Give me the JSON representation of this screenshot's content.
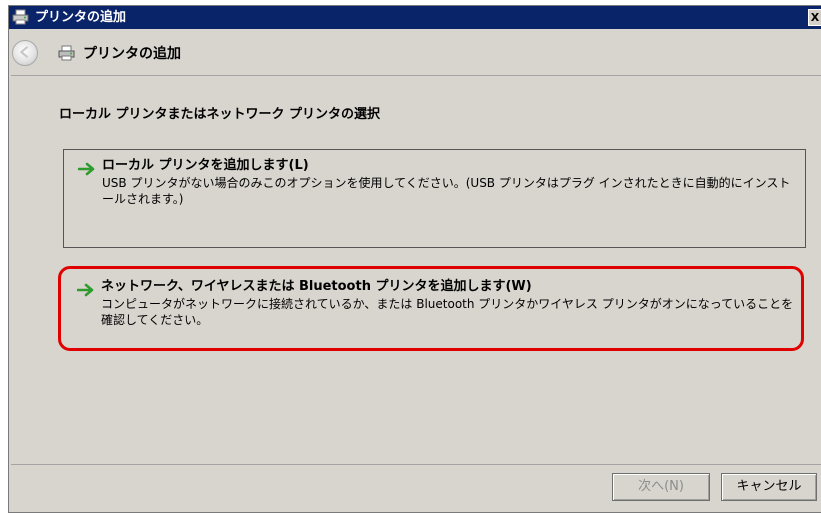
{
  "window": {
    "title": "プリンタの追加",
    "close_label": "X"
  },
  "nav": {
    "title": "プリンタの追加"
  },
  "main": {
    "heading": "ローカル プリンタまたはネットワーク プリンタの選択",
    "options": [
      {
        "title": "ローカル プリンタを追加します(L)",
        "description": "USB プリンタがない場合のみこのオプションを使用してください。(USB プリンタはプラグ インされたときに自動的にインストールされます。)"
      },
      {
        "title": "ネットワーク、ワイヤレスまたは Bluetooth プリンタを追加します(W)",
        "description": "コンピュータがネットワークに接続されているか、または Bluetooth プリンタかワイヤレス プリンタがオンになっていることを確認してください。",
        "highlighted": true
      }
    ]
  },
  "buttons": {
    "next_label": "次へ(N)",
    "next_enabled": false,
    "cancel_label": "キャンセル"
  },
  "colors": {
    "titlebar": "#0a246a",
    "highlight": "#e00000",
    "arrow": "#2e9b2e"
  },
  "icons": {
    "title": "printer-icon",
    "back": "back-arrow-icon",
    "nav": "printer-icon",
    "option": "green-arrow-icon"
  }
}
